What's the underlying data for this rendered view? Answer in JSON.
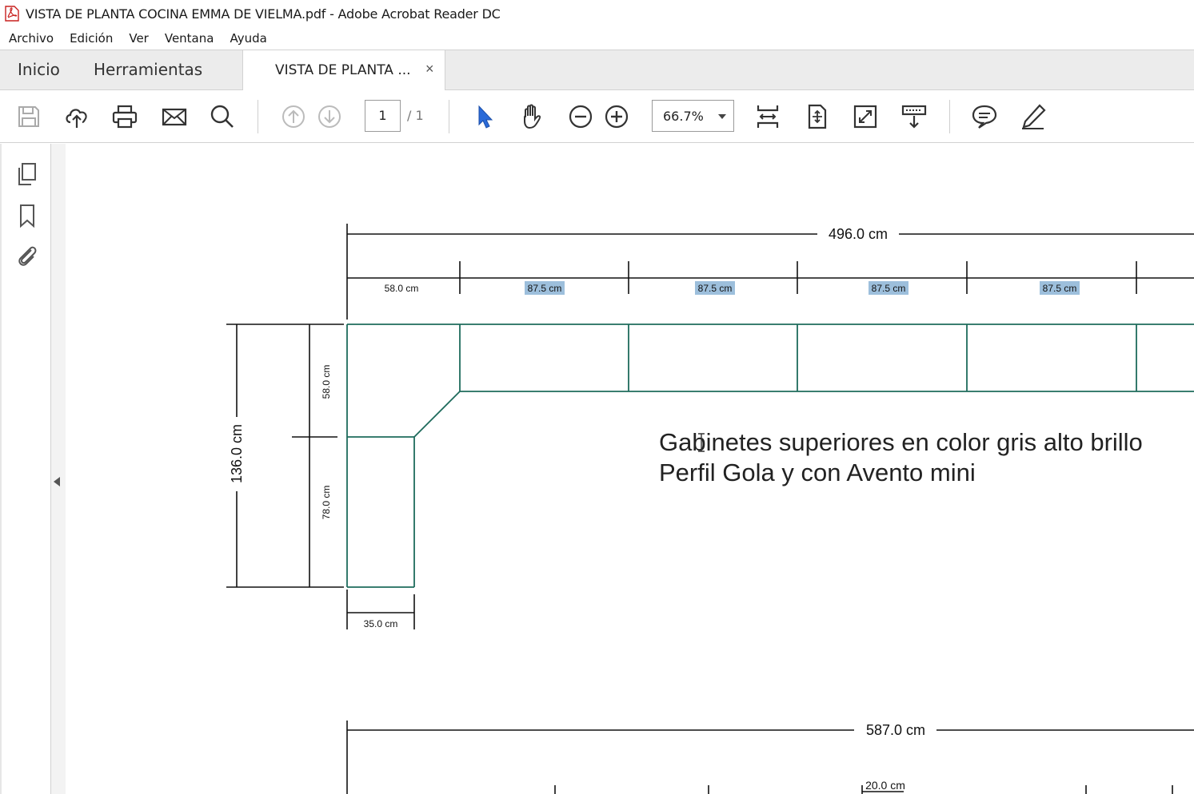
{
  "window": {
    "title": "VISTA DE PLANTA COCINA EMMA DE VIELMA.pdf - Adobe Acrobat Reader DC"
  },
  "menu": [
    "Archivo",
    "Edición",
    "Ver",
    "Ventana",
    "Ayuda"
  ],
  "tabs": {
    "home": "Inicio",
    "tools": "Herramientas",
    "document": "VISTA DE PLANTA ...",
    "close_glyph": "×"
  },
  "toolbar": {
    "page_current": "1",
    "page_total": "/ 1",
    "zoom": "66.7%",
    "icons": [
      "save-icon",
      "cloud-upload-icon",
      "print-icon",
      "email-icon",
      "search-icon",
      "page-up-icon",
      "page-down-icon",
      "select-cursor-icon",
      "hand-icon",
      "zoom-out-icon",
      "zoom-in-icon",
      "fit-width-icon",
      "fit-page-icon",
      "full-screen-icon",
      "scroll-mode-icon",
      "comment-icon",
      "pen-icon"
    ]
  },
  "sidebar": {
    "icons": [
      "pages-icon",
      "bookmark-icon",
      "attachment-icon"
    ]
  },
  "document": {
    "dim_total_top": "496.0 cm",
    "dim_top_segments": [
      "58.0 cm",
      "87.5 cm",
      "87.5 cm",
      "87.5 cm",
      "87.5 cm"
    ],
    "dim_height_total": "136.0 cm",
    "dim_height_upper": "58.0 cm",
    "dim_height_lower": "78.0 cm",
    "dim_bottom_width": "35.0 cm",
    "note_line1": "Gabinetes superiores en color gris alto brillo",
    "note_line2": "Perfil Gola y con Avento mini",
    "dim_total_bottom": "587.0 cm",
    "dim_bottom_partial": "20.0 cm"
  },
  "colors": {
    "cabinet_line": "#1e6b5c",
    "text_highlight": "#9dbfdc",
    "accent_cursor": "#2a6ad8"
  }
}
